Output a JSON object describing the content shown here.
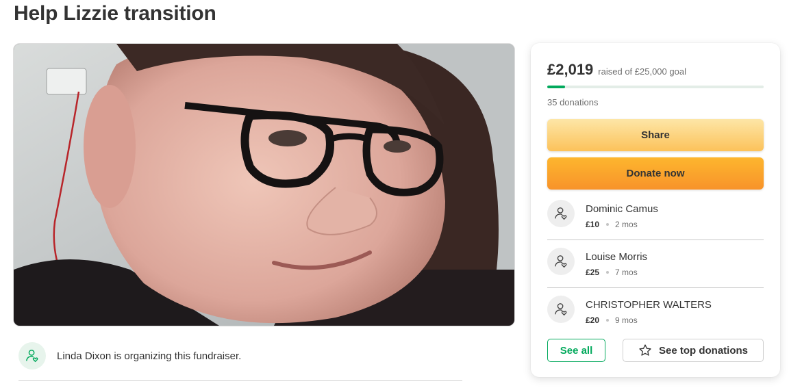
{
  "campaign": {
    "title": "Help Lizzie transition"
  },
  "organizer": {
    "text": "Linda Dixon is organizing this fundraiser.",
    "icon": "person-heart-icon"
  },
  "donation_card": {
    "raised": "£2,019",
    "goal_text": "raised of £25,000 goal",
    "progress_fraction": 0.0808,
    "donation_count": "35 donations",
    "share_label": "Share",
    "donate_label": "Donate now",
    "recent_donations": [
      {
        "name": "Dominic Camus",
        "amount": "£10",
        "time": "2 mos"
      },
      {
        "name": "Louise Morris",
        "amount": "£25",
        "time": "7 mos"
      },
      {
        "name": "CHRISTOPHER WALTERS",
        "amount": "£20",
        "time": "9 mos"
      }
    ],
    "see_all_label": "See all",
    "top_donations_label": "See top donations"
  },
  "colors": {
    "brand_green": "#02a95c",
    "share_button": "#fcc25a",
    "donate_button": "#f8932a"
  }
}
